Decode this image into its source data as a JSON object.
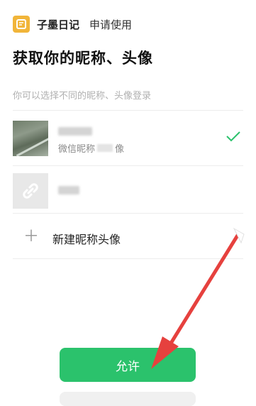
{
  "header": {
    "app_name": "子墨日记",
    "request_label": "申请使用"
  },
  "main": {
    "title": "获取你的昵称、头像",
    "subtitle": "你可以选择不同的昵称、头像登录"
  },
  "options": [
    {
      "name": "",
      "source_prefix": "微信昵称",
      "source_suffix": "像",
      "selected": true
    },
    {
      "name": "",
      "selected": false
    }
  ],
  "new_profile": {
    "label": "新建昵称头像"
  },
  "allow_button": {
    "label": "允许"
  },
  "colors": {
    "accent_green": "#2bc26c",
    "logo_yellow": "#f1b53a",
    "arrow_red": "#e6413e"
  },
  "icons": [
    "app-logo-icon",
    "link-icon",
    "checkmark-icon",
    "plus-icon",
    "annotation-arrow-icon"
  ]
}
